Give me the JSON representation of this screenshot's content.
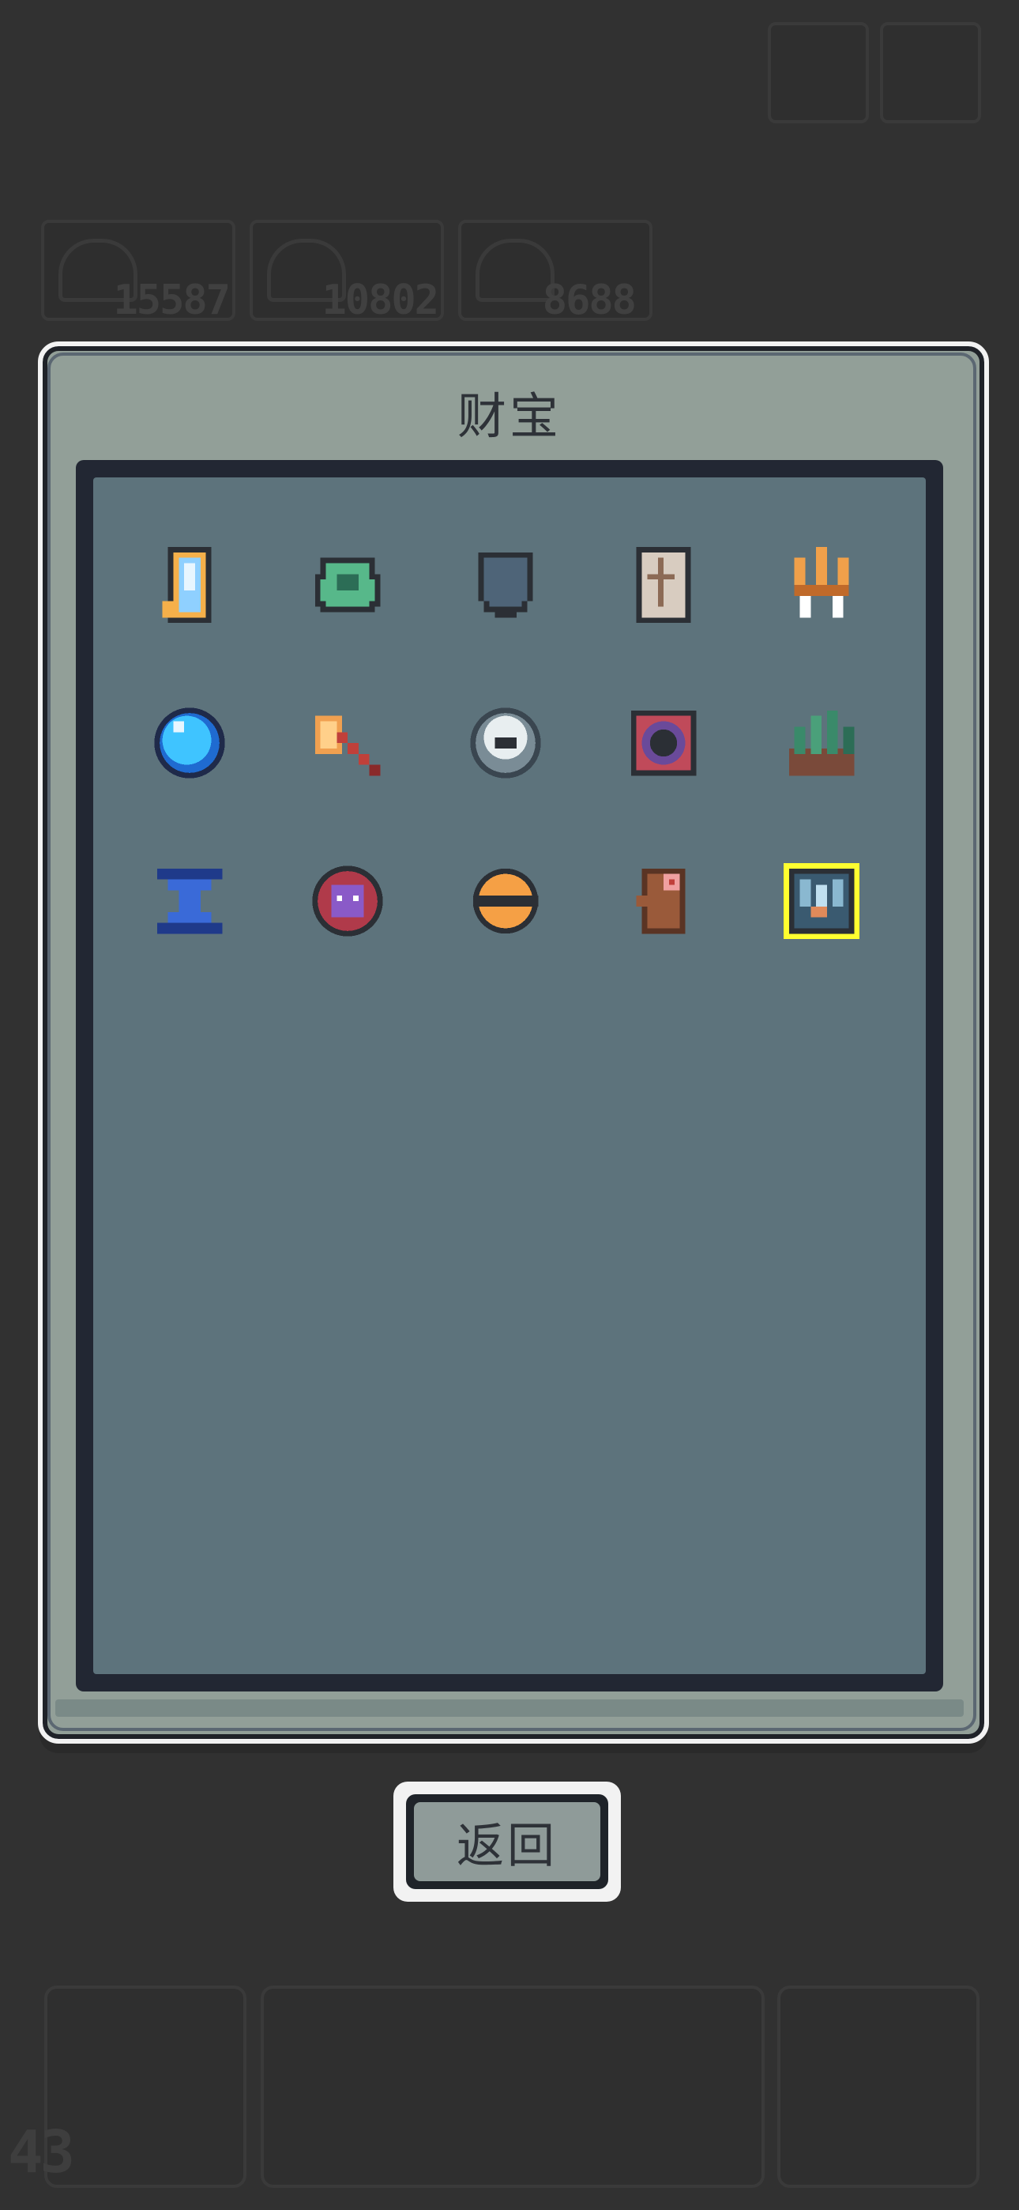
{
  "resources": [
    {
      "value": "15587",
      "icon": "resource-icon"
    },
    {
      "value": "10802",
      "icon": "resource-icon"
    },
    {
      "value": "8688",
      "icon": "resource-icon"
    }
  ],
  "dialog": {
    "title": "财宝",
    "back_label": "返回"
  },
  "treasures": [
    {
      "name": "crystal-mirror",
      "colors": [
        "#8fd0ff",
        "#f5b04a"
      ]
    },
    {
      "name": "green-helmet",
      "colors": [
        "#57b88a",
        "#2c6d56"
      ]
    },
    {
      "name": "blue-shield",
      "colors": [
        "#4e6478",
        "#2a3846"
      ]
    },
    {
      "name": "rune-scroll",
      "colors": [
        "#d8ccc0",
        "#8c6a55"
      ]
    },
    {
      "name": "golden-trident",
      "colors": [
        "#f0a04a",
        "#ffffff"
      ]
    },
    {
      "name": "blue-orb",
      "colors": [
        "#3fc4ff",
        "#1f6bd1"
      ]
    },
    {
      "name": "flame-axe",
      "colors": [
        "#f0a050",
        "#c0403a"
      ]
    },
    {
      "name": "white-spiral",
      "colors": [
        "#e8eef0",
        "#7a8c96"
      ]
    },
    {
      "name": "void-portal",
      "colors": [
        "#6a4a9a",
        "#c04a5a"
      ]
    },
    {
      "name": "crystal-cluster",
      "colors": [
        "#3a8a6a",
        "#7a4a3a"
      ]
    },
    {
      "name": "blue-hourglass",
      "colors": [
        "#3a6ad8",
        "#1f3a8a"
      ]
    },
    {
      "name": "demon-emblem",
      "colors": [
        "#8a5ac8",
        "#b03a4a"
      ]
    },
    {
      "name": "gold-ring",
      "colors": [
        "#f5a045",
        "#2b2f35"
      ]
    },
    {
      "name": "wooden-totem",
      "colors": [
        "#9a5a3a",
        "#f0a0a0"
      ]
    },
    {
      "name": "ice-crown",
      "colors": [
        "#3a5a70",
        "#ffff30"
      ],
      "selected": true
    }
  ],
  "bottom_bar": {
    "level": "43"
  },
  "colors": {
    "background": "#313131",
    "panel": "#929f98",
    "grid": "#5d737c",
    "selected_outline": "#ffff30"
  }
}
